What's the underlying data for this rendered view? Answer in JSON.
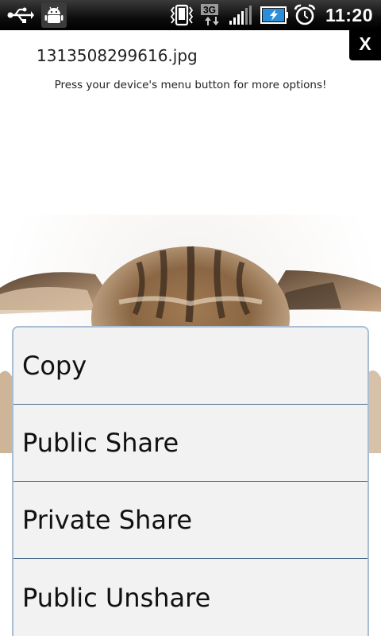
{
  "status_bar": {
    "time": "11:20",
    "network_label": "3G",
    "icons": [
      "usb-icon",
      "android-debug-icon",
      "vibrate-icon",
      "3g-data-icon",
      "signal-strength-icon",
      "battery-charging-icon",
      "alarm-icon"
    ]
  },
  "close_button": {
    "label": "X"
  },
  "header": {
    "file_name": "1313508299616.jpg",
    "hint": "Press your device's menu button for more options!"
  },
  "context_menu": {
    "items": [
      {
        "label": "Copy"
      },
      {
        "label": "Public Share"
      },
      {
        "label": "Private Share"
      },
      {
        "label": "Public Unshare"
      }
    ]
  },
  "colors": {
    "status_bar": "#000000",
    "menu_background": "#f2f2f2",
    "menu_border": "#a9bed3",
    "menu_divider": "#4a6a8a",
    "battery_fill": "#2a8fd8"
  }
}
